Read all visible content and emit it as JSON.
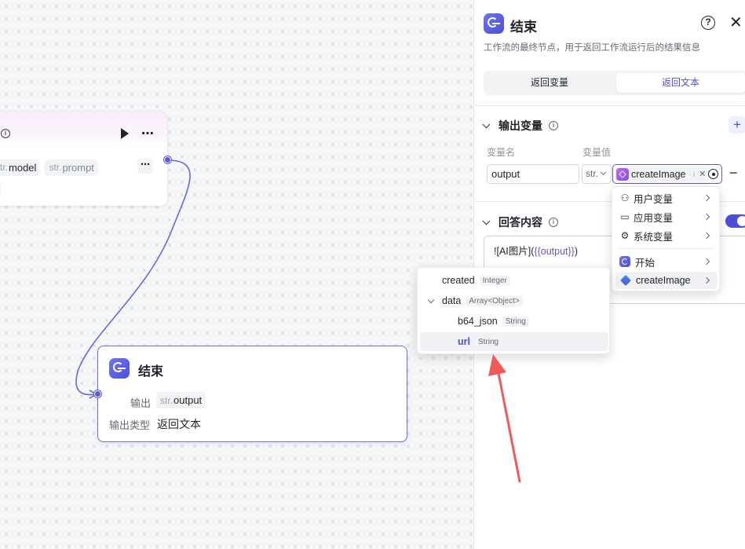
{
  "canvas": {
    "top_node": {
      "params": [
        {
          "type": "str.",
          "name": "model"
        },
        {
          "type": "str.",
          "name": "prompt"
        }
      ],
      "more_label": "⋯",
      "dots_label": "⋯"
    },
    "end_node": {
      "title": "结束",
      "output_label": "输出",
      "output_tag_type": "str.",
      "output_tag_name": "output",
      "output_type_label": "输出类型",
      "output_type_value": "返回文本"
    }
  },
  "panel": {
    "title": "结束",
    "description": "工作流的最终节点，用于返回工作流运行后的结果信息",
    "tabs": [
      "返回变量",
      "返回文本"
    ],
    "active_tab": "返回文本",
    "output_section": {
      "title": "输出变量",
      "col_name": "变量名",
      "col_value": "变量值",
      "var_name": "output",
      "var_type": "str.",
      "ref_node": "createImage",
      "ref_sub": "· i"
    },
    "answer_section": {
      "title": "回答内容",
      "toggle_on": true,
      "content_prefix": "![AI图片](",
      "content_var": "{{output}}",
      "content_suffix": ")"
    }
  },
  "dropdown": {
    "items": [
      {
        "label": "用户变量",
        "icon": "user-icon"
      },
      {
        "label": "应用变量",
        "icon": "folder-icon"
      },
      {
        "label": "系统变量",
        "icon": "gear-icon"
      },
      {
        "label": "开始",
        "icon": "start-node-icon"
      },
      {
        "label": "createImage",
        "icon": "create-image-node-icon"
      }
    ]
  },
  "subpopup": {
    "rows": [
      {
        "name": "created",
        "type": "Integer"
      },
      {
        "name": "data",
        "type": "Array<Object>"
      },
      {
        "name": "b64_json",
        "type": "String"
      },
      {
        "name": "url",
        "type": "String"
      }
    ],
    "selected": "url"
  },
  "colors": {
    "accent": "#4a4fd8",
    "arrow": "#ef5b5b",
    "connector": "#5b5bd6"
  }
}
